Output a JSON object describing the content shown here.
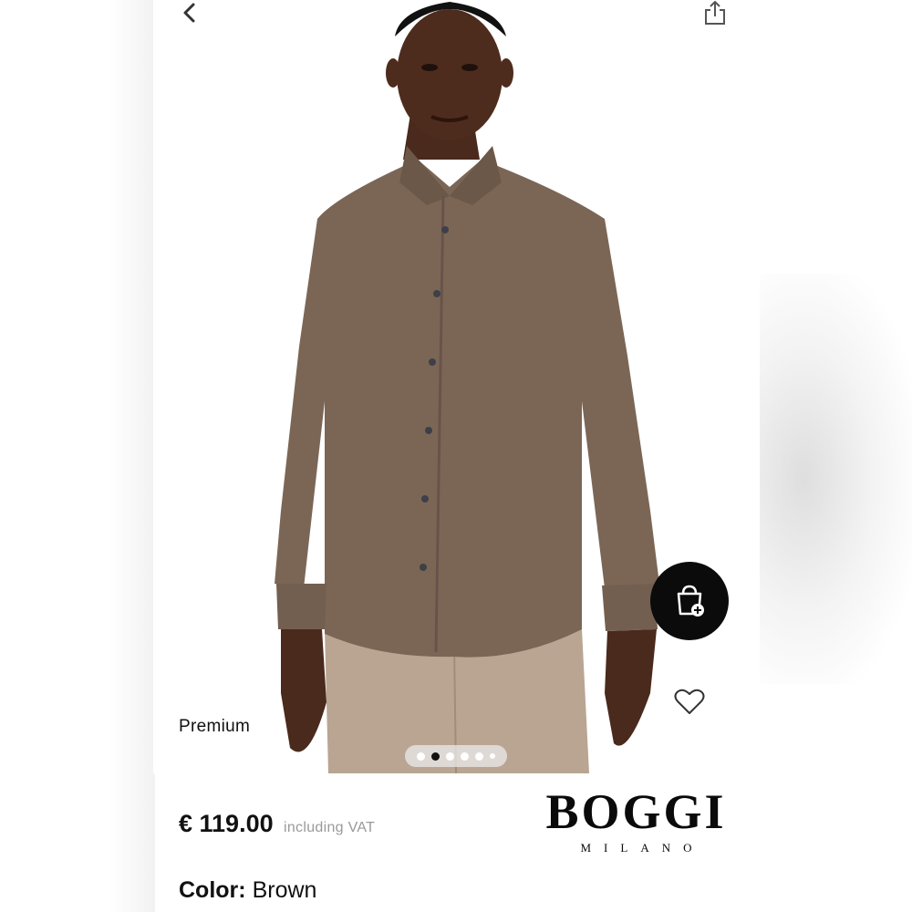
{
  "header": {
    "back_icon": "chevron-left-icon",
    "share_icon": "share-icon"
  },
  "product": {
    "tag": "Premium",
    "price": "€ 119.00",
    "vat_note": "including VAT",
    "color_label": "Color:",
    "color_value": "Brown",
    "image": "brown long-sleeve shirt worn by model",
    "shirt_color": "#7b6656",
    "trouser_color": "#b9a592"
  },
  "actions": {
    "cart_icon": "shopping-bag-plus-icon",
    "wishlist_icon": "heart-icon"
  },
  "carousel": {
    "count": 6,
    "active_index": 1
  },
  "brand": {
    "name": "BOGGI",
    "subtitle": "MILANO"
  },
  "colors": {
    "accent": "#0b0b0b",
    "muted_text": "#9a9a9a"
  }
}
